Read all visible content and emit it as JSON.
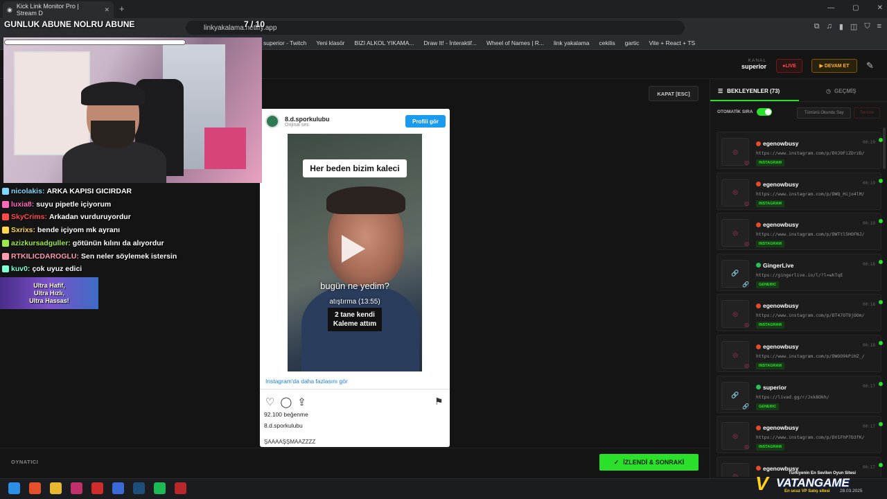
{
  "browser": {
    "tab_title": "Kick Link Monitor Pro | Stream D",
    "tab_close": "✕",
    "new_tab": "+",
    "url": "linkyakalama.netlify.app",
    "window_controls": [
      "—",
      "▢",
      "✕"
    ],
    "bookmarks": [
      "superior - Twitch",
      "Yeni klasör",
      "BIZI ALKOL YIKAMA...",
      "Draw It! - İnteraktif...",
      "Wheel of Names | R...",
      "link yakalama",
      "cekilis",
      "gartic",
      "Vite + React + TS"
    ]
  },
  "header": {
    "kanal_label": "KANAL",
    "kanal_value": "superior",
    "live_label": "LIVE",
    "devam_label": "DEVAM ET"
  },
  "player": {
    "kapat_label": "KAPAT [ESC]",
    "footer_label": "OYNATICI",
    "next_label": "İZLENDİ & SONRAKİ"
  },
  "instagram": {
    "username": "8.d.sporkulubu",
    "audio": "Orijinal ses",
    "profile_button": "Profili gör",
    "video_caption_top": "Her beden bizim kaleci",
    "video_caption_mid": "bugün ne yedim?",
    "video_caption_time": "atıştırma (13:55)",
    "video_caption_box_1": "2 tane kendi",
    "video_caption_box_2": "Kaleme attım",
    "more_link": "Instagram'da daha fazlasını gör",
    "likes": "92.100 beğenme",
    "owner": "8.d.sporkulubu",
    "caption": "ŞAAAAŞŞMAAZZZZ"
  },
  "queue": {
    "tab_waiting": "BEKLEYENLER (73)",
    "tab_history": "GEÇMİŞ",
    "auto_label": "OTOMATİK SIRA",
    "mark_all": "Tümünü Okundu Say",
    "clear": "Temizle",
    "items": [
      {
        "name": "egenowbusy",
        "time": "00:19",
        "url": "https://www.instagram.com/p/DVJOFiZDrzD/",
        "badge": "INSTAGRAM",
        "kind": "ig"
      },
      {
        "name": "egenowbusy",
        "time": "00:19",
        "url": "https://www.instagram.com/p/DWQ_Hijo4lM/",
        "badge": "INSTAGRAM",
        "kind": "ig"
      },
      {
        "name": "egenowbusy",
        "time": "00:19",
        "url": "https://www.instagram.com/p/DWTtl5HOFNJ/",
        "badge": "INSTAGRAM",
        "kind": "ig"
      },
      {
        "name": "GingerLive",
        "time": "00:18",
        "url": "https://gingerlive.io/l/?l=wkTqE",
        "badge": "GENERIC",
        "kind": "gen"
      },
      {
        "name": "egenowbusy",
        "time": "00:18",
        "url": "https://www.instagram.com/p/DT47OT9jOOm/",
        "badge": "INSTAGRAM",
        "kind": "ig"
      },
      {
        "name": "egenowbusy",
        "time": "00:18",
        "url": "https://www.instagram.com/p/DWOO9kPiHZ_/",
        "badge": "INSTAGRAM",
        "kind": "ig"
      },
      {
        "name": "superior",
        "time": "00:17",
        "url": "https://livad.gg/r/Jxk8Okh/",
        "badge": "GENERIC",
        "kind": "gen"
      },
      {
        "name": "egenowbusy",
        "time": "00:17",
        "url": "https://www.instagram.com/p/DV1FhP7D3fK/",
        "badge": "INSTAGRAM",
        "kind": "ig"
      },
      {
        "name": "egenowbusy",
        "time": "00:17",
        "url": "",
        "badge": "",
        "kind": "ig"
      }
    ]
  },
  "overlay": {
    "title": "GUNLUK ABUNE NOLRU ABUNE",
    "counter": "7 / 10",
    "ultra_1": "Ultra Hafif,",
    "ultra_2": "Ultra Hızlı,",
    "ultra_3": "Ultra Hassas!",
    "chat": [
      {
        "user": "nicolakis:",
        "msg": "ARKA KAPISI GICIRDAR",
        "color": "#7fd6ff"
      },
      {
        "user": "luxia8:",
        "msg": "suyu pipetle içiyorum",
        "color": "#ff6ab8"
      },
      {
        "user": "SkyCrims:",
        "msg": "Arkadan vurduruyordur",
        "color": "#ff4a4a"
      },
      {
        "user": "Sxrixs:",
        "msg": "bende içiyom mk ayranı",
        "color": "#ffd84a"
      },
      {
        "user": "azizkursadguller:",
        "msg": "götünün kılını da alıyordur",
        "color": "#9be84a"
      },
      {
        "user": "RTKILICDAROGLU:",
        "msg": "Sen neler söylemek istersin",
        "color": "#ff9ab0"
      },
      {
        "user": "kuv0:",
        "msg": "çok uyuz edici",
        "color": "#7fffd4"
      }
    ]
  },
  "watermark": {
    "line1": "Türkiyenin En Sevilen Oyun Sitesi",
    "brand": "VATANGAME",
    "line2": "En ucuz VP Satış sitesi",
    "date": "28.03.2025"
  }
}
